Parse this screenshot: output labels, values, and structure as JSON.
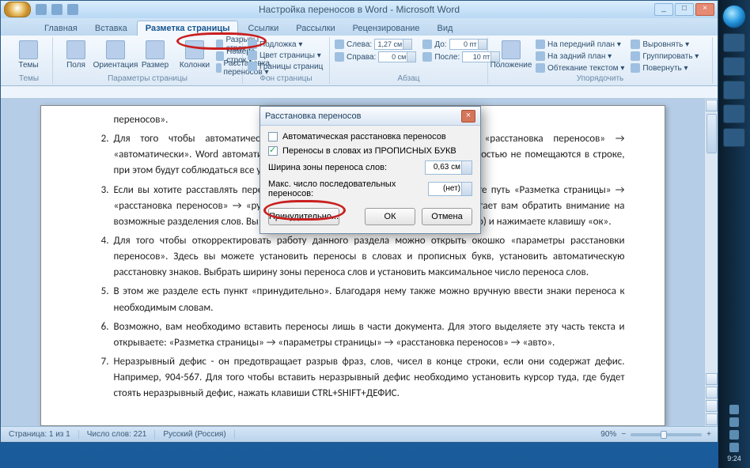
{
  "window": {
    "title": "Настройка переносов в Word - Microsoft Word",
    "min": "_",
    "max": "□",
    "close": "×"
  },
  "tabs": {
    "t0": "Главная",
    "t1": "Вставка",
    "t2": "Разметка страницы",
    "t3": "Ссылки",
    "t4": "Рассылки",
    "t5": "Рецензирование",
    "t6": "Вид"
  },
  "ribbon": {
    "themes_label": "Темы",
    "themes_btn": "Темы",
    "page_setup_label": "Параметры страницы",
    "margins": "Поля",
    "orient": "Ориентация",
    "size": "Размер",
    "cols": "Колонки",
    "breaks": "Разрывы строк ▾",
    "lines": "Номера строк ▾",
    "hyph": "Расстановка переносов ▾",
    "bg_label": "Фон страницы",
    "wm": "Подложка ▾",
    "color": "Цвет страницы ▾",
    "borders": "Границы страниц",
    "para_label": "Абзац",
    "indL": "Слева:",
    "indR": "Справа:",
    "spB": "До:",
    "spA": "После:",
    "indL_v": "1,27 см",
    "indR_v": "0 см",
    "spB_v": "0 пт",
    "spA_v": "10 пт",
    "arrange_label": "Упорядочить",
    "pos": "Положение",
    "front": "На передний план ▾",
    "back": "На задний план ▾",
    "wrap": "Обтекание текстом ▾",
    "align": "Выровнять ▾",
    "group": "Группировать ▾",
    "rotate": "Повернуть ▾"
  },
  "doc": {
    "p1": "переносов».",
    "p2": "Для того чтобы автоматически расставлять переносы открываете путь «расстановка переносов» → «автоматически». Word автоматически сделает переносы в словах, которые полностью не помещаются в строке, при этом будут соблюдаться все условия переноса.",
    "p3": "Если вы хотите расставлять переносы лишь в отдельных местах, тогда выбираете путь «Разметка страницы» → «расстановка переносов» → «ручная». Здесь Microsoft Office Word 2007 предлагает вам обратить внимание на возможные разделения слов. Вы корректируете, исправляете (если это необходимо) и нажимаете клавишу «ок».",
    "p4": "Для того чтобы откорректировать работу данного раздела можно открыть окошко «параметры расстановки переносов». Здесь вы можете установить переносы в словах и прописных букв, установить автоматическую расстановку знаков. Выбрать ширину зоны переноса слов и установить максимальное число переноса слов.",
    "p5": "В этом же разделе есть пункт «принудительно». Благодаря нему также можно вручную ввести знаки переноса к необходимым словам.",
    "p6": "Возможно, вам необходимо вставить переносы лишь в части документа. Для этого выделяете эту часть текста и открываете: «Разметка страницы» → «параметры страницы» → «расстановка переносов» → «авто».",
    "p7": "Неразрывный дефис - он предотвращает разрыв фраз, слов, чисел в конце строки, если они содержат дефис. Например, 904-567. Для того чтобы вставить неразрывный дефис необходимо установить курсор туда, где будет стоять неразрывный дефис, нажать клавиши CTRL+SHIFT+ДЕФИС."
  },
  "dialog": {
    "title": "Расстановка переносов",
    "chk1": "Автоматическая расстановка переносов",
    "chk2": "Переносы в словах из ПРОПИСНЫХ БУКВ",
    "opt1": "Ширина зоны переноса слов:",
    "opt1_v": "0,63 см",
    "opt2": "Макс. число последовательных переносов:",
    "opt2_v": "(нет)",
    "btn_force": "Принудительно...",
    "ok": "ОК",
    "cancel": "Отмена",
    "close": "×"
  },
  "status": {
    "page": "Страница: 1 из 1",
    "words": "Число слов: 221",
    "lang": "Русский (Россия)",
    "zoom": "90%",
    "zm_minus": "−",
    "zm_plus": "+"
  },
  "taskbar": {
    "time": "9:24"
  }
}
